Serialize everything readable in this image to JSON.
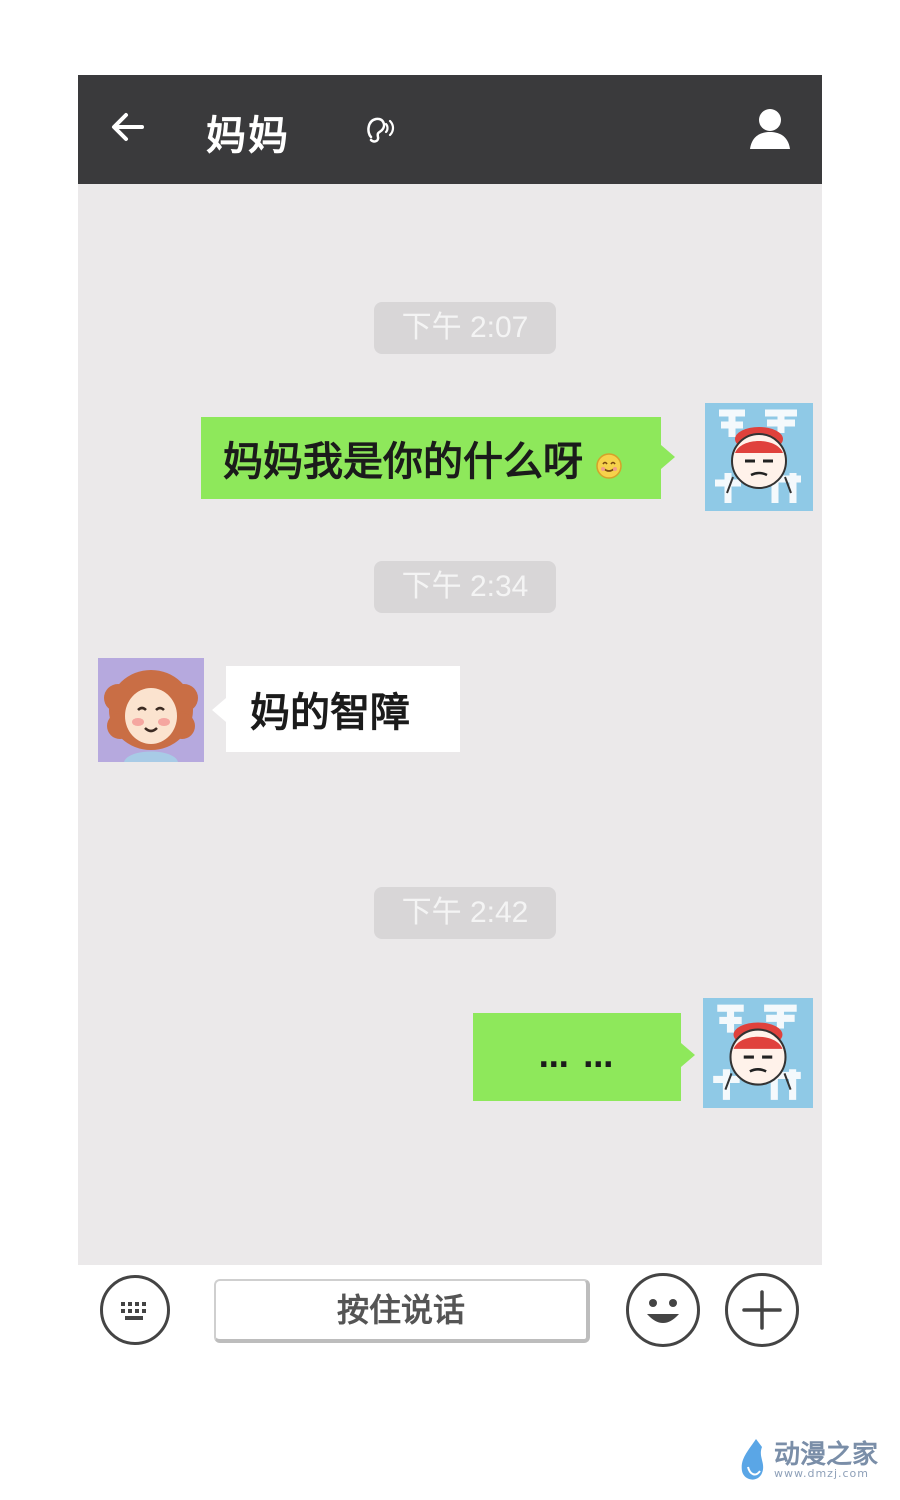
{
  "header": {
    "title": "妈妈",
    "back_icon": "back-arrow-icon",
    "ear_icon": "earpiece-mode-icon",
    "profile_icon": "person-icon"
  },
  "messages": [
    {
      "type": "timestamp",
      "text": "下午 2:07"
    },
    {
      "type": "sent",
      "text": "妈妈我是你的什么呀",
      "emoji": "smile-emoji"
    },
    {
      "type": "timestamp",
      "text": "下午 2:34"
    },
    {
      "type": "received",
      "text": "妈的智障"
    },
    {
      "type": "timestamp",
      "text": "下午 2:42"
    },
    {
      "type": "sent",
      "text": "… …"
    }
  ],
  "inputbar": {
    "hold_to_talk": "按住说话",
    "keyboard_icon": "keyboard-icon",
    "emoji_icon": "emoji-face-icon",
    "plus_icon": "plus-icon"
  },
  "watermark": {
    "name": "动漫之家",
    "url": "www.dmzj.com"
  },
  "colors": {
    "topbar": "#3a3a3c",
    "chat_bg": "#ebe9ea",
    "sent_bubble": "#8ee85b",
    "received_bubble": "#ffffff",
    "timestamp_bg": "#d8d6d7"
  }
}
